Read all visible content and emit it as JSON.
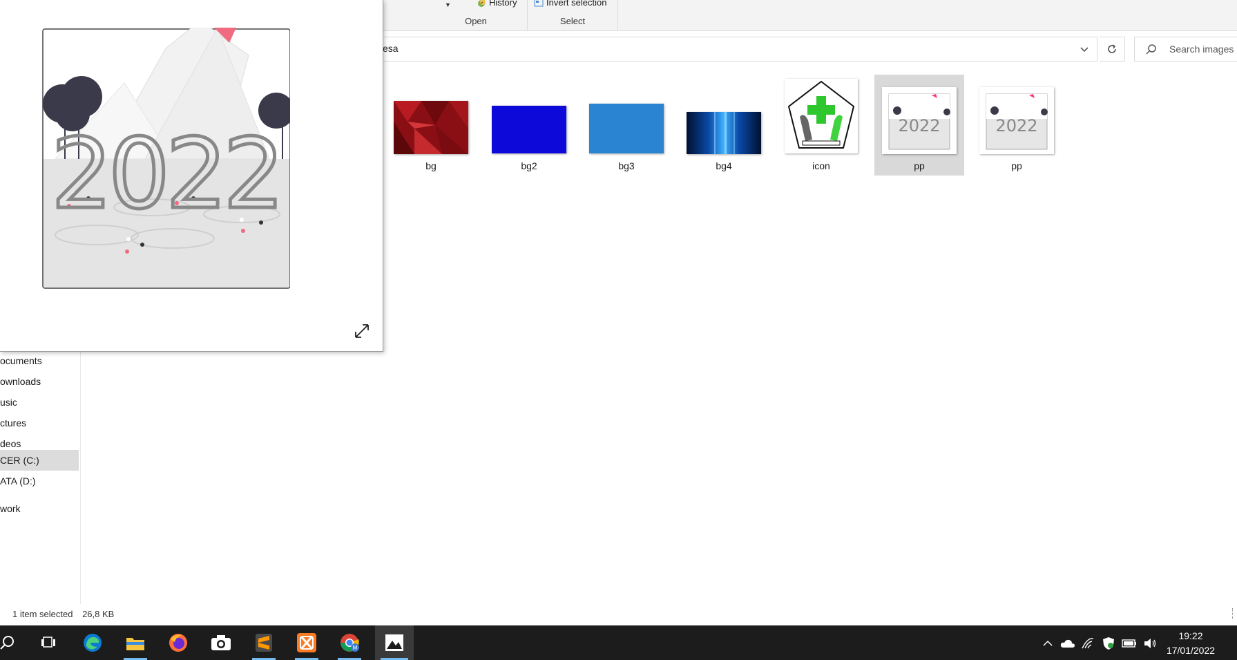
{
  "ribbon": {
    "history_label": "History",
    "invert_selection_label": "Invert selection",
    "open_group_label": "Open",
    "select_group_label": "Select"
  },
  "address": {
    "path_text": "esa",
    "search_placeholder": "Search images"
  },
  "nav": {
    "items": [
      "ocuments",
      "ownloads",
      "usic",
      "ctures",
      "deos",
      "CER (C:)",
      "ATA (D:)",
      "work"
    ],
    "selected_index": 5
  },
  "files": [
    {
      "label": "bg"
    },
    {
      "label": "bg2"
    },
    {
      "label": "bg3"
    },
    {
      "label": "bg4"
    },
    {
      "label": "icon"
    },
    {
      "label": "pp",
      "selected": true
    },
    {
      "label": "pp"
    }
  ],
  "preview": {
    "year_text": "2022"
  },
  "status": {
    "selection_text": "1 item selected",
    "size_text": "26,8 KB"
  },
  "taskbar": {
    "apps": [
      "search-icon",
      "task-view-icon",
      "edge-icon",
      "file-explorer-icon",
      "firefox-icon",
      "camera-icon",
      "sublime-text-icon",
      "xampp-icon",
      "chrome-icon",
      "photos-icon"
    ],
    "active_app": "photos-icon",
    "time": "19:22",
    "date": "17/01/2022"
  },
  "colors": {
    "taskbar_bg": "#1c1c1c",
    "accent": "#76b9ed",
    "selection_bg": "#d9d9d9"
  }
}
